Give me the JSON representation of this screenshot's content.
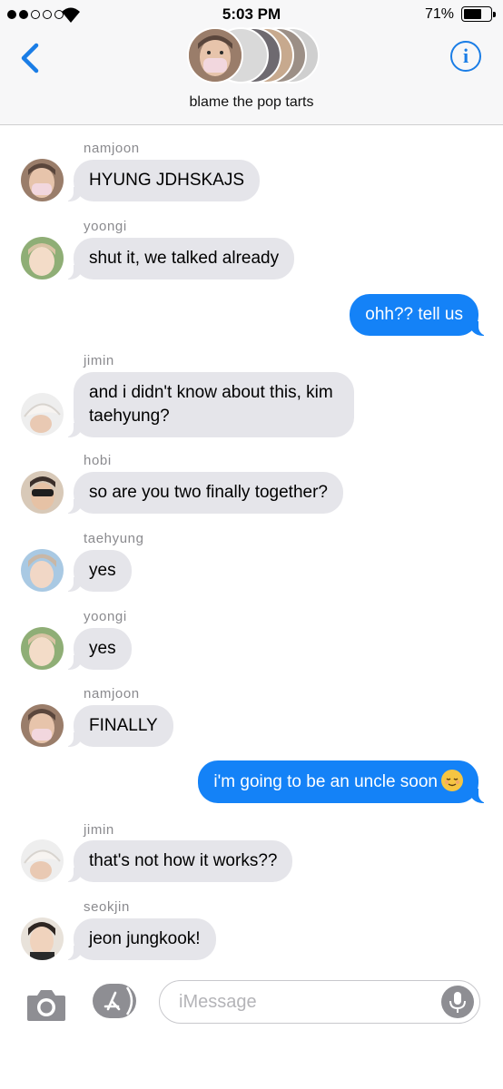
{
  "status_bar": {
    "time": "5:03 PM",
    "battery_percent": "71%",
    "battery_level": 0.71,
    "signal_bars_filled": 2,
    "signal_bars_total": 5
  },
  "header": {
    "group_name": "blame the pop tarts",
    "back_icon": "chevron-left-icon",
    "info_icon": "info-icon"
  },
  "colors": {
    "accent": "#1a7de6",
    "outgoing_bubble": "#1482f7",
    "incoming_bubble": "#e5e5ea",
    "sender_label": "#8a8a8e"
  },
  "messages": [
    {
      "direction": "in",
      "sender": "namjoon",
      "text": "HYUNG JDHSKAJS"
    },
    {
      "direction": "in",
      "sender": "yoongi",
      "text": "shut it, we talked already"
    },
    {
      "direction": "out",
      "text": "ohh?? tell us"
    },
    {
      "direction": "in",
      "sender": "jimin",
      "text": "and i didn't know about this, kim taehyung?"
    },
    {
      "direction": "in",
      "sender": "hobi",
      "text": "so are you two finally together?"
    },
    {
      "direction": "in",
      "sender": "taehyung",
      "text": "yes"
    },
    {
      "direction": "in",
      "sender": "yoongi",
      "text": "yes"
    },
    {
      "direction": "in",
      "sender": "namjoon",
      "text": "FINALLY"
    },
    {
      "direction": "out",
      "text": "i'm going to be an uncle soon",
      "emoji": "relieved-face-icon"
    },
    {
      "direction": "in",
      "sender": "jimin",
      "text": "that's not how it works??"
    },
    {
      "direction": "in",
      "sender": "seokjin",
      "text": "jeon jungkook!"
    }
  ],
  "input": {
    "placeholder": "iMessage",
    "camera_icon": "camera-icon",
    "apps_icon": "app-store-icon",
    "mic_icon": "microphone-icon"
  }
}
